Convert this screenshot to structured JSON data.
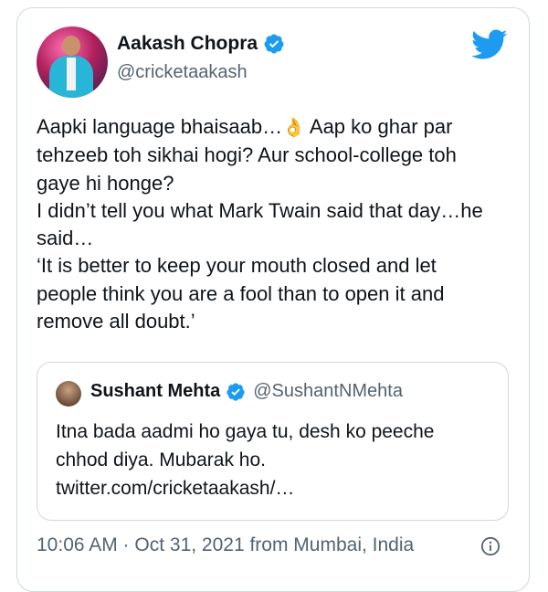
{
  "author": {
    "name": "Aakash Chopra",
    "handle": "@cricketaakash"
  },
  "tweet": {
    "lines": [
      "Aapki language bhaisaab…",
      "tehzeeb toh sikhai hogi? Aur school-college toh",
      "gaye hi honge?",
      "I didn’t tell you what Mark Twain said that day…he",
      "said…",
      "‘It is better to keep your mouth closed and let",
      "people think you are a fool than to open it and",
      "remove all doubt.’"
    ],
    "emoji": "👌",
    "line1_tail": " Aap ko ghar par"
  },
  "quote": {
    "name": "Sushant Mehta",
    "handle": "@SushantNMehta",
    "lines": [
      "Itna bada aadmi ho gaya tu, desh ko peeche",
      "chhod diya. Mubarak ho.",
      "twitter.com/cricketaakash/…"
    ]
  },
  "meta": {
    "text": "10:06 AM · Oct 31, 2021 from Mumbai, India"
  },
  "icons": {
    "verified": "verified-badge-icon",
    "bird": "twitter-bird-icon",
    "info": "info-icon"
  },
  "colors": {
    "brand_blue": "#1d9bf0",
    "secondary_text": "#536471",
    "border": "#cfd9de"
  }
}
